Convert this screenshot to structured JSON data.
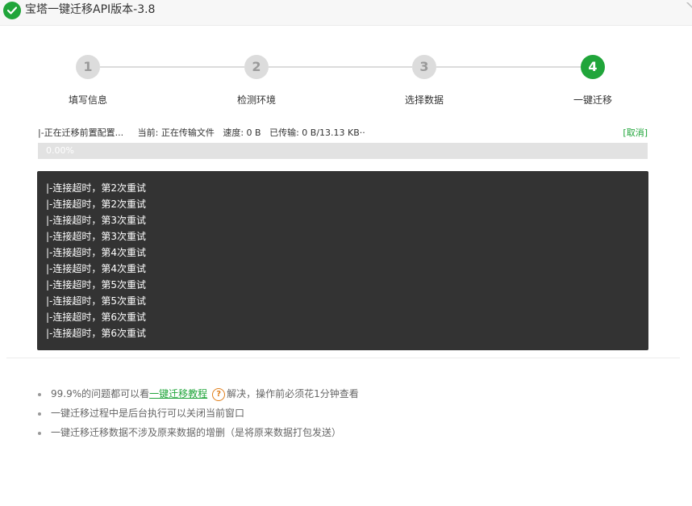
{
  "window": {
    "title": "宝塔一键迁移API版本-3.8",
    "title_icon": "check-circle-icon"
  },
  "steps": [
    {
      "number": "1",
      "label": "填写信息",
      "active": false
    },
    {
      "number": "2",
      "label": "检测环境",
      "active": false
    },
    {
      "number": "3",
      "label": "选择数据",
      "active": false
    },
    {
      "number": "4",
      "label": "一键迁移",
      "active": true
    }
  ],
  "status": {
    "text": "|-正在迁移前置配置...     当前: 正在传输文件   速度: 0 B   已传输: 0 B/13.13 KB··",
    "cancel": "[取消]"
  },
  "progress": {
    "value": 0,
    "label": "0.00%"
  },
  "log": [
    "|-连接超时，第2次重试",
    "|-连接超时，第2次重试",
    "|-连接超时，第3次重试",
    "|-连接超时，第3次重试",
    "|-连接超时，第4次重试",
    "|-连接超时，第4次重试",
    "|-连接超时，第5次重试",
    "|-连接超时，第5次重试",
    "|-连接超时，第6次重试",
    "|-连接超时，第6次重试"
  ],
  "tips": {
    "tip1_prefix": "99.9%的问题都可以看",
    "tip1_link": "一键迁移教程",
    "tip1_help": "?",
    "tip1_suffix": "解决，操作前必须花1分钟查看",
    "tip2": "一键迁移过程中是后台执行可以关闭当前窗口",
    "tip3": "一键迁移迁移数据不涉及原来数据的增删（是将原来数据打包发送）"
  },
  "colors": {
    "accent": "#20a53a",
    "step_inactive": "#dcdcdc",
    "log_background": "#333333",
    "help_icon": "#e07f1c"
  }
}
